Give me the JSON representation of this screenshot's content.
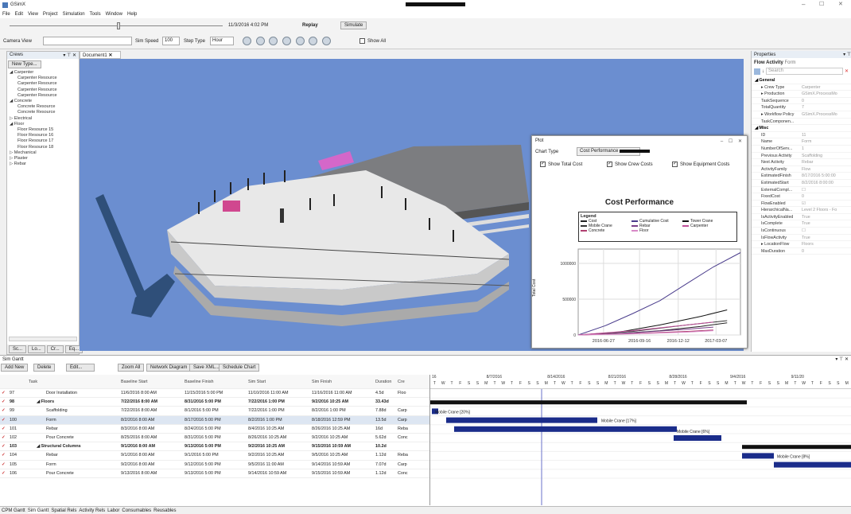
{
  "app": {
    "title": "GSimX",
    "menu": [
      "File",
      "Edit",
      "View",
      "Project",
      "Simulation",
      "Tools",
      "Window",
      "Help"
    ]
  },
  "toolbar": {
    "datetime": "11/3/2016 4:02 PM",
    "replay": "Replay",
    "simulate": "Simulate",
    "camera_label": "Camera View",
    "sim_speed_label": "Sim Speed",
    "sim_speed_value": "100",
    "step_type_label": "Step Type",
    "step_type_value": "Hour",
    "show_all": "Show All"
  },
  "crews": {
    "title": "Crews",
    "new_type": "New Type...",
    "tree": [
      {
        "t": "◢ Carpenter",
        "l": 0
      },
      {
        "t": "Carpenter Resource",
        "l": 2
      },
      {
        "t": "Carpenter Resource",
        "l": 2
      },
      {
        "t": "Carpenter Resource",
        "l": 2
      },
      {
        "t": "Carpenter Resource",
        "l": 2
      },
      {
        "t": "◢ Concrete",
        "l": 0
      },
      {
        "t": "Concrete Resource",
        "l": 2
      },
      {
        "t": "Concrete Resource",
        "l": 2
      },
      {
        "t": "▷ Electrical",
        "l": 0
      },
      {
        "t": "◢ Floor",
        "l": 0
      },
      {
        "t": "Floor Resource 15",
        "l": 2
      },
      {
        "t": "Floor Resource 16",
        "l": 2
      },
      {
        "t": "Floor Resource 17",
        "l": 2
      },
      {
        "t": "Floor Resource 18",
        "l": 2
      },
      {
        "t": "▷ Mechanical",
        "l": 0
      },
      {
        "t": "▷ Plaster",
        "l": 0
      },
      {
        "t": "▷ Rebar",
        "l": 0
      }
    ],
    "bottom_tabs": [
      "Sc...",
      "Lo...",
      "Cr...",
      "Eq..."
    ]
  },
  "document": {
    "tab": "Document1"
  },
  "plot": {
    "title": "Plot",
    "chart_type_label": "Chart Type",
    "chart_type_value": "Cost Performance",
    "show_total": "Show Total Cost",
    "show_crew": "Show Crew Costs",
    "show_equip": "Show Equipment Costs",
    "chart_title": "Cost Performance",
    "legend_title": "Legend",
    "ylabel": "Total Cost"
  },
  "chart_data": {
    "type": "line",
    "title": "Cost Performance",
    "ylabel": "Total Cost",
    "xlabel": "",
    "x_ticks": [
      "2016-06-27",
      "2016-09-16",
      "2016-12-12",
      "2017-03-07"
    ],
    "y_ticks": [
      "0",
      "500000",
      "1000000"
    ],
    "ylim": [
      0,
      1200000
    ],
    "series": [
      {
        "name": "Cost",
        "color": "#222222",
        "x": [
          "2016-05-01",
          "2016-08-01",
          "2016-11-01",
          "2017-02-01",
          "2017-04-01"
        ],
        "y": [
          0,
          20000,
          60000,
          120000,
          170000
        ]
      },
      {
        "name": "Cumulative Cost",
        "color": "#4a3c8c",
        "x": [
          "2016-05-01",
          "2016-07-01",
          "2016-09-01",
          "2016-11-01",
          "2017-01-01",
          "2017-03-01",
          "2017-05-01"
        ],
        "y": [
          0,
          130000,
          300000,
          480000,
          720000,
          950000,
          1150000
        ]
      },
      {
        "name": "Tower Crane",
        "color": "#111111",
        "x": [
          "2016-05-01",
          "2016-08-01",
          "2016-11-01",
          "2017-02-01",
          "2017-04-01"
        ],
        "y": [
          0,
          40000,
          140000,
          260000,
          350000
        ]
      },
      {
        "name": "Mobile Crane",
        "color": "#333333",
        "x": [
          "2016-05-01",
          "2016-09-01",
          "2017-01-01",
          "2017-04-01"
        ],
        "y": [
          0,
          50000,
          140000,
          200000
        ]
      },
      {
        "name": "Rebar",
        "color": "#7a3f8a",
        "x": [
          "2016-05-01",
          "2016-09-01",
          "2017-01-01",
          "2017-03-01"
        ],
        "y": [
          0,
          30000,
          80000,
          110000
        ]
      },
      {
        "name": "Carpenter",
        "color": "#c0509a",
        "x": [
          "2016-05-01",
          "2016-09-01",
          "2017-01-01",
          "2017-03-01"
        ],
        "y": [
          0,
          60000,
          140000,
          180000
        ]
      },
      {
        "name": "Concrete",
        "color": "#b04070",
        "x": [
          "2016-05-01",
          "2016-09-01",
          "2017-01-01",
          "2017-03-01"
        ],
        "y": [
          0,
          20000,
          50000,
          70000
        ]
      },
      {
        "name": "Floor",
        "color": "#d889c7",
        "x": [
          "2016-05-01",
          "2016-09-01",
          "2017-01-01",
          "2017-03-01"
        ],
        "y": [
          0,
          15000,
          40000,
          60000
        ]
      }
    ]
  },
  "props": {
    "title": "Properties",
    "subtitle": "Flow Activity",
    "subtitle2": "Form",
    "search": "Search",
    "rows": [
      {
        "k": "◢ General",
        "v": "",
        "s": true
      },
      {
        "k": "▸ Crew Type",
        "v": "Carpenter"
      },
      {
        "k": "▸ Production",
        "v": "GSimX.ProcessMo"
      },
      {
        "k": "TaskSequence",
        "v": "0"
      },
      {
        "k": "TotalQuantity",
        "v": "7"
      },
      {
        "k": "▸ Workflow Policy",
        "v": "GSimX.ProcessMo"
      },
      {
        "k": "TaskComponen...",
        "v": ""
      },
      {
        "k": "◢ Misc",
        "v": "",
        "s": true
      },
      {
        "k": "ID",
        "v": "11"
      },
      {
        "k": "Name",
        "v": "Form"
      },
      {
        "k": "NumberOfServ...",
        "v": "1"
      },
      {
        "k": "Previous Activity",
        "v": "Scaffolding"
      },
      {
        "k": "Next Activity",
        "v": "Rebar"
      },
      {
        "k": "ActivityFamily",
        "v": "Flow"
      },
      {
        "k": "EstimatedFinish",
        "v": "8/17/2016 5:00:00"
      },
      {
        "k": "EstimatedStart",
        "v": "8/2/2016 8:00:00"
      },
      {
        "k": "ExternalCompl...",
        "v": "☐"
      },
      {
        "k": "FixedCost",
        "v": "0"
      },
      {
        "k": "FlowEnabled",
        "v": "☑"
      },
      {
        "k": "HierarchicalNa...",
        "v": "Level 2 Floors - Fo"
      },
      {
        "k": "IsActivityEnabled",
        "v": "True"
      },
      {
        "k": "IsComplete",
        "v": "True"
      },
      {
        "k": "IsContinuous",
        "v": "☐"
      },
      {
        "k": "IsFlowActivity",
        "v": "True"
      },
      {
        "k": "▸ LocationFlow",
        "v": "Floors"
      },
      {
        "k": "MaxDuration",
        "v": "0"
      }
    ]
  },
  "gantt": {
    "title": "Sim Gantt",
    "buttons": [
      "Add New",
      "Delete",
      "Edit...",
      "Zoom All",
      "Network Diagram",
      "Save XML...",
      "Schedule Chart"
    ],
    "headers": [
      "Task",
      "Baseline Start",
      "Baseline Finish",
      "Sim Start",
      "Sim Finish",
      "Duration",
      "Cre"
    ],
    "rows": [
      {
        "id": "97",
        "task": "Door Installation",
        "bs": "11/6/2016 8:00 AM",
        "bf": "11/15/2016 5:00 PM",
        "ss": "11/10/2016 11:00 AM",
        "sf": "11/16/2016 11:00 AM",
        "d": "4.5d",
        "c": "Floo",
        "b": false,
        "i": 1
      },
      {
        "id": "98",
        "task": "◢ Floors",
        "bs": "7/22/2016 8:00 AM",
        "bf": "8/31/2016 5:00 PM",
        "ss": "7/22/2016 1:00 PM",
        "sf": "9/2/2016 10:25 AM",
        "d": "33.43d",
        "c": "",
        "b": true,
        "i": 0
      },
      {
        "id": "99",
        "task": "Scaffolding",
        "bs": "7/22/2016 8:00 AM",
        "bf": "8/1/2016 5:00 PM",
        "ss": "7/22/2016 1:00 PM",
        "sf": "8/2/2016 1:00 PM",
        "d": "7.88d",
        "c": "Carp",
        "b": false,
        "i": 1
      },
      {
        "id": "100",
        "task": "Form",
        "bs": "8/2/2016 8:00 AM",
        "bf": "8/17/2016 5:00 PM",
        "ss": "8/2/2016 1:00 PM",
        "sf": "8/18/2016 12:59 PM",
        "d": "13.5d",
        "c": "Carp",
        "b": false,
        "i": 1
      },
      {
        "id": "101",
        "task": "Rebar",
        "bs": "8/3/2016 8:00 AM",
        "bf": "8/24/2016 5:00 PM",
        "ss": "8/4/2016 10:25 AM",
        "sf": "8/26/2016 10:25 AM",
        "d": "16d",
        "c": "Reba",
        "b": false,
        "i": 1
      },
      {
        "id": "102",
        "task": "Pour Concrete",
        "bs": "8/25/2016 8:00 AM",
        "bf": "8/31/2016 5:00 PM",
        "ss": "8/26/2016 10:25 AM",
        "sf": "9/2/2016 10:25 AM",
        "d": "5.62d",
        "c": "Conc",
        "b": false,
        "i": 1
      },
      {
        "id": "103",
        "task": "◢ Structural Columns",
        "bs": "9/1/2016 8:00 AM",
        "bf": "9/13/2016 5:00 PM",
        "ss": "9/2/2016 10:25 AM",
        "sf": "9/15/2016 10:59 AM",
        "d": "10.2d",
        "c": "",
        "b": true,
        "i": 0
      },
      {
        "id": "104",
        "task": "Rebar",
        "bs": "9/1/2016 8:00 AM",
        "bf": "9/1/2016 5:00 PM",
        "ss": "9/2/2016 10:25 AM",
        "sf": "9/5/2016 10:25 AM",
        "d": "1.12d",
        "c": "Reba",
        "b": false,
        "i": 1
      },
      {
        "id": "105",
        "task": "Form",
        "bs": "9/2/2016 8:00 AM",
        "bf": "9/12/2016 5:00 PM",
        "ss": "9/5/2016 11:00 AM",
        "sf": "9/14/2016 10:59 AM",
        "d": "7.07d",
        "c": "Carp",
        "b": false,
        "i": 1
      },
      {
        "id": "106",
        "task": "Pour Concrete",
        "bs": "9/13/2016 8:00 AM",
        "bf": "9/13/2016 5:00 PM",
        "ss": "9/14/2016 10:59 AM",
        "sf": "9/15/2016 10:59 AM",
        "d": "1.12d",
        "c": "Conc",
        "b": false,
        "i": 1
      }
    ],
    "weeks": [
      "16",
      "8/7/2016",
      "8/14/2016",
      "8/21/2016",
      "8/28/2016",
      "9/4/2016",
      "9/11/20"
    ],
    "days": [
      "T",
      "W",
      "T",
      "F",
      "S",
      "S",
      "M",
      "T",
      "W",
      "T",
      "F",
      "S",
      "S",
      "M",
      "T",
      "W",
      "T",
      "F",
      "S",
      "S",
      "M",
      "T",
      "W",
      "T",
      "F",
      "S",
      "S",
      "M",
      "T",
      "W",
      "T",
      "F",
      "S",
      "S",
      "M",
      "T",
      "W",
      "T",
      "F",
      "S",
      "S",
      "M",
      "T",
      "W",
      "T",
      "F",
      "S",
      "S",
      "M"
    ],
    "bar_labels": {
      "a": "Mobile Crane [20%]",
      "b": "Mobile Crane [17%]",
      "c": "Mobile Crane [6%]",
      "d": "Mobile Crane [8%]"
    }
  },
  "bottom_tabs": [
    "CPM Gantt",
    "Sim Gantt",
    "Spatial Rels",
    "Activity Rels",
    "Labor",
    "Consumables",
    "Reusables"
  ]
}
